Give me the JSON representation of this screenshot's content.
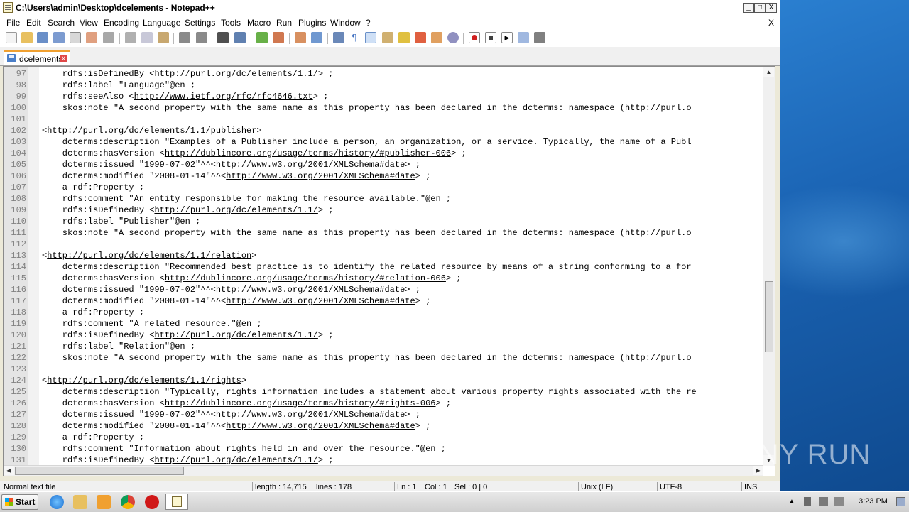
{
  "window": {
    "title": "C:\\Users\\admin\\Desktop\\dcelements - Notepad++",
    "controls": {
      "minimize": "_",
      "maximize": "□",
      "close": "X"
    }
  },
  "menu": {
    "items": [
      "File",
      "Edit",
      "Search",
      "View",
      "Encoding",
      "Language",
      "Settings",
      "Tools",
      "Macro",
      "Run",
      "Plugins",
      "Window",
      "?"
    ],
    "close_doc": "X"
  },
  "tab": {
    "label": "dcelements",
    "close": "x"
  },
  "editor": {
    "lines": [
      {
        "n": "97",
        "t": "    rdfs:isDefinedBy <",
        "u": "http://purl.org/dc/elements/1.1/",
        "r": "> ;"
      },
      {
        "n": "98",
        "t": "    rdfs:label \"Language\"@en ;",
        "u": "",
        "r": ""
      },
      {
        "n": "99",
        "t": "    rdfs:seeAlso <",
        "u": "http://www.ietf.org/rfc/rfc4646.txt",
        "r": "> ;"
      },
      {
        "n": "100",
        "t": "    skos:note \"A second property with the same name as this property has been declared in the dcterms: namespace (",
        "u": "http://purl.o",
        "r": ""
      },
      {
        "n": "101",
        "t": "",
        "u": "",
        "r": ""
      },
      {
        "n": "102",
        "t": "<",
        "u": "http://purl.org/dc/elements/1.1/publisher",
        "r": ">"
      },
      {
        "n": "103",
        "t": "    dcterms:description \"Examples of a Publisher include a person, an organization, or a service. Typically, the name of a Publ",
        "u": "",
        "r": ""
      },
      {
        "n": "104",
        "t": "    dcterms:hasVersion <",
        "u": "http://dublincore.org/usage/terms/history/#publisher-006",
        "r": "> ;"
      },
      {
        "n": "105",
        "t": "    dcterms:issued \"1999-07-02\"^^<",
        "u": "http://www.w3.org/2001/XMLSchema#date",
        "r": "> ;"
      },
      {
        "n": "106",
        "t": "    dcterms:modified \"2008-01-14\"^^<",
        "u": "http://www.w3.org/2001/XMLSchema#date",
        "r": "> ;"
      },
      {
        "n": "107",
        "t": "    a rdf:Property ;",
        "u": "",
        "r": ""
      },
      {
        "n": "108",
        "t": "    rdfs:comment \"An entity responsible for making the resource available.\"@en ;",
        "u": "",
        "r": ""
      },
      {
        "n": "109",
        "t": "    rdfs:isDefinedBy <",
        "u": "http://purl.org/dc/elements/1.1/",
        "r": "> ;"
      },
      {
        "n": "110",
        "t": "    rdfs:label \"Publisher\"@en ;",
        "u": "",
        "r": ""
      },
      {
        "n": "111",
        "t": "    skos:note \"A second property with the same name as this property has been declared in the dcterms: namespace (",
        "u": "http://purl.o",
        "r": ""
      },
      {
        "n": "112",
        "t": "",
        "u": "",
        "r": ""
      },
      {
        "n": "113",
        "t": "<",
        "u": "http://purl.org/dc/elements/1.1/relation",
        "r": ">"
      },
      {
        "n": "114",
        "t": "    dcterms:description \"Recommended best practice is to identify the related resource by means of a string conforming to a for",
        "u": "",
        "r": ""
      },
      {
        "n": "115",
        "t": "    dcterms:hasVersion <",
        "u": "http://dublincore.org/usage/terms/history/#relation-006",
        "r": "> ;"
      },
      {
        "n": "116",
        "t": "    dcterms:issued \"1999-07-02\"^^<",
        "u": "http://www.w3.org/2001/XMLSchema#date",
        "r": "> ;"
      },
      {
        "n": "117",
        "t": "    dcterms:modified \"2008-01-14\"^^<",
        "u": "http://www.w3.org/2001/XMLSchema#date",
        "r": "> ;"
      },
      {
        "n": "118",
        "t": "    a rdf:Property ;",
        "u": "",
        "r": ""
      },
      {
        "n": "119",
        "t": "    rdfs:comment \"A related resource.\"@en ;",
        "u": "",
        "r": ""
      },
      {
        "n": "120",
        "t": "    rdfs:isDefinedBy <",
        "u": "http://purl.org/dc/elements/1.1/",
        "r": "> ;"
      },
      {
        "n": "121",
        "t": "    rdfs:label \"Relation\"@en ;",
        "u": "",
        "r": ""
      },
      {
        "n": "122",
        "t": "    skos:note \"A second property with the same name as this property has been declared in the dcterms: namespace (",
        "u": "http://purl.o",
        "r": ""
      },
      {
        "n": "123",
        "t": "",
        "u": "",
        "r": ""
      },
      {
        "n": "124",
        "t": "<",
        "u": "http://purl.org/dc/elements/1.1/rights",
        "r": ">"
      },
      {
        "n": "125",
        "t": "    dcterms:description \"Typically, rights information includes a statement about various property rights associated with the re",
        "u": "",
        "r": ""
      },
      {
        "n": "126",
        "t": "    dcterms:hasVersion <",
        "u": "http://dublincore.org/usage/terms/history/#rights-006",
        "r": "> ;"
      },
      {
        "n": "127",
        "t": "    dcterms:issued \"1999-07-02\"^^<",
        "u": "http://www.w3.org/2001/XMLSchema#date",
        "r": "> ;"
      },
      {
        "n": "128",
        "t": "    dcterms:modified \"2008-01-14\"^^<",
        "u": "http://www.w3.org/2001/XMLSchema#date",
        "r": "> ;"
      },
      {
        "n": "129",
        "t": "    a rdf:Property ;",
        "u": "",
        "r": ""
      },
      {
        "n": "130",
        "t": "    rdfs:comment \"Information about rights held in and over the resource.\"@en ;",
        "u": "",
        "r": ""
      },
      {
        "n": "131",
        "t": "    rdfs:isDefinedBy <",
        "u": "http://purl.org/dc/elements/1.1/",
        "r": "> ;"
      }
    ]
  },
  "status": {
    "file_type": "Normal text file",
    "length": "length : 14,715",
    "lines": "lines : 178",
    "ln": "Ln : 1",
    "col": "Col : 1",
    "sel": "Sel : 0 | 0",
    "eol": "Unix (LF)",
    "encoding": "UTF-8",
    "mode": "INS"
  },
  "taskbar": {
    "start": "Start",
    "clock": "3:23 PM",
    "apps": [
      "internet-explorer-icon",
      "file-explorer-icon",
      "media-player-icon",
      "chrome-icon",
      "opera-icon",
      "notepadpp-icon"
    ]
  },
  "watermark": {
    "text": "ANY RUN"
  },
  "colors": {
    "tab_accent": "#f0a030",
    "desktop": "#1b64b4"
  }
}
